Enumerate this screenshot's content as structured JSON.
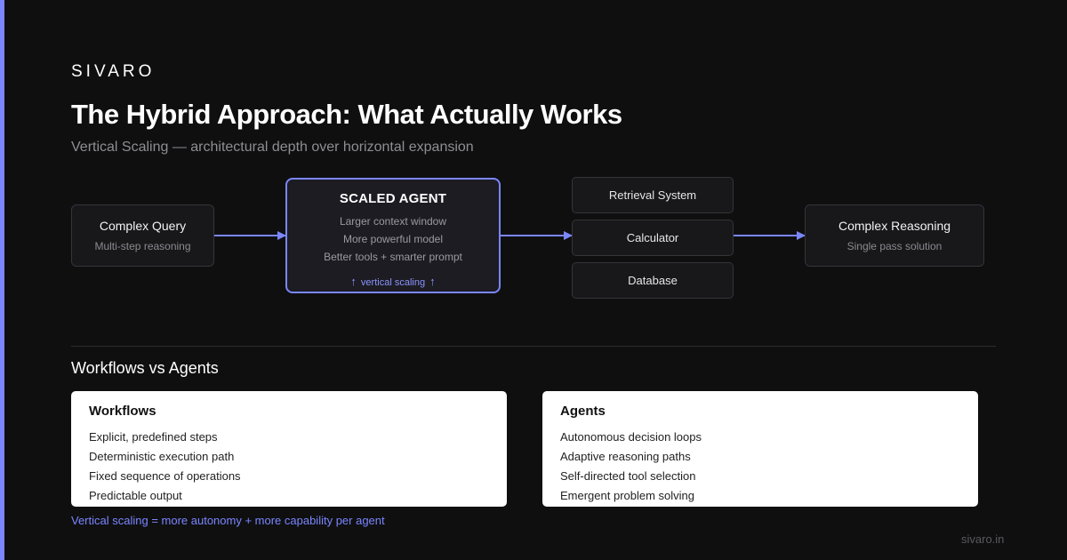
{
  "brand": "SIVARO",
  "title": "The Hybrid Approach: What Actually Works",
  "subtitle": "Vertical Scaling — architectural depth over horizontal expansion",
  "diagram": {
    "input": {
      "title": "Complex Query",
      "sub": "Multi-step reasoning"
    },
    "agent": {
      "title": "SCALED AGENT",
      "lines": [
        "Larger context window",
        "More powerful model",
        "Better tools + smarter prompt"
      ],
      "arrow_glyph": "↑",
      "vertical_label": "vertical scaling"
    },
    "tools": [
      "Retrieval System",
      "Calculator",
      "Database"
    ],
    "output": {
      "title": "Complex Reasoning",
      "sub": "Single pass solution"
    },
    "accent_color": "#7b86ff"
  },
  "section": {
    "title": "Workflows vs Agents"
  },
  "workflows": {
    "title": "Workflows",
    "items": [
      "Explicit, predefined steps",
      "Deterministic execution path",
      "Fixed sequence of operations",
      "Predictable output"
    ]
  },
  "agents": {
    "title": "Agents",
    "items": [
      "Autonomous decision loops",
      "Adaptive reasoning paths",
      "Self-directed tool selection",
      "Emergent problem solving"
    ]
  },
  "footnote": "Vertical scaling = more autonomy + more capability per agent",
  "site": "sivaro.in"
}
